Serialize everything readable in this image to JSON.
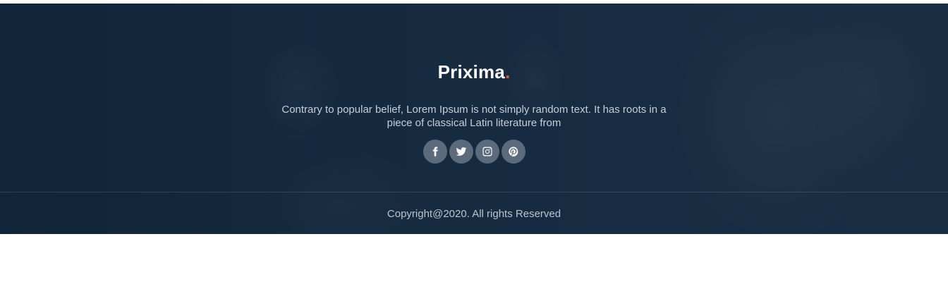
{
  "footer": {
    "brand": {
      "name": "Prixima",
      "dot": ".",
      "dot_color": "#e4513a"
    },
    "description": "Contrary to popular belief, Lorem Ipsum is not simply random text. It has roots in a piece of classical Latin literature from",
    "social": [
      {
        "icon": "facebook-icon"
      },
      {
        "icon": "twitter-icon"
      },
      {
        "icon": "instagram-icon"
      },
      {
        "icon": "pinterest-icon"
      }
    ],
    "copyright": "Copyright@2020. All rights Reserved",
    "colors": {
      "overlay": "#1a2e44",
      "text": "#c7ced7",
      "accent": "#e4513a"
    }
  }
}
